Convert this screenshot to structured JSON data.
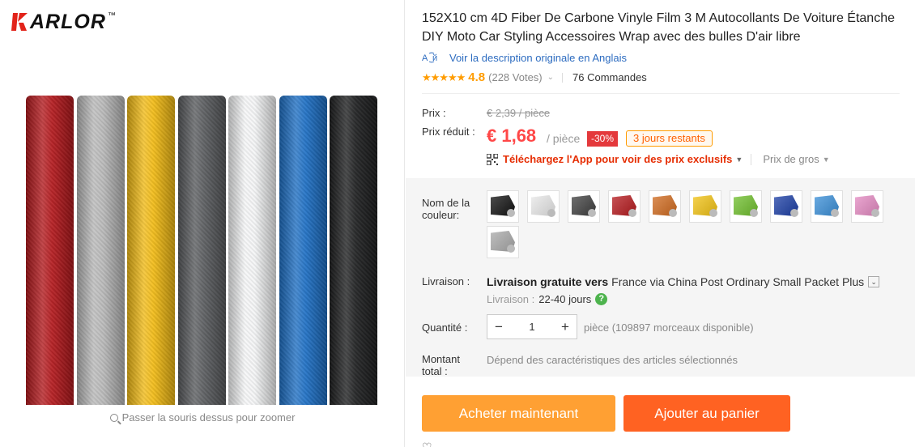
{
  "brand": {
    "name": "ARLOR",
    "tm": "™"
  },
  "gallery": {
    "roll_colors": [
      "#b3181c",
      "#b8b8b8",
      "#f2bb14",
      "#595b5e",
      "#f4f5f6",
      "#1d6fc4",
      "#1e1f20"
    ],
    "zoom_hint": "Passer la souris dessus pour zoomer"
  },
  "product": {
    "title": "152X10 cm 4D Fiber De Carbone Vinyle Film 3 M Autocollants De Voiture Étanche DIY Moto Car Styling Accessoires Wrap avec des bulles D'air libre",
    "original_link": "Voir la description originale en Anglais",
    "rating": "4.8",
    "votes": "(228 Votes)",
    "orders": "76 Commandes"
  },
  "price": {
    "label_price": "Prix :",
    "old": "€ 2,39 / pièce",
    "label_reduced": "Prix réduit :",
    "new": "€ 1,68",
    "per": "/ pièce",
    "discount": "-30%",
    "days_left": "3 jours restants",
    "app_promo": "Téléchargez l'App pour voir des prix exclusifs",
    "wholesale": "Prix de gros"
  },
  "options": {
    "color_label": "Nom de la couleur:",
    "colors": [
      "#111111",
      "#e8e8e8",
      "#3f3f3f",
      "#b5191d",
      "#d06a1e",
      "#f2c314",
      "#6fbf2c",
      "#1b3ea5",
      "#3a8fd8",
      "#e48ac2",
      "#a9a9a9"
    ],
    "shipping_label": "Livraison :",
    "shipping_free": "Livraison gratuite vers",
    "shipping_carrier": "France via China Post Ordinary Small Packet Plus",
    "delivery_label": "Livraison :",
    "delivery_days": "22-40 jours",
    "qty_label": "Quantité :",
    "qty_minus": "−",
    "qty_value": "1",
    "qty_plus": "+",
    "stock": "pièce (109897 morceaux disponible)",
    "total_label": "Montant total :",
    "total_note": "Dépend des caractéristiques des articles sélectionnés"
  },
  "actions": {
    "buy_now": "Acheter maintenant",
    "add_cart": "Ajouter au panier"
  }
}
